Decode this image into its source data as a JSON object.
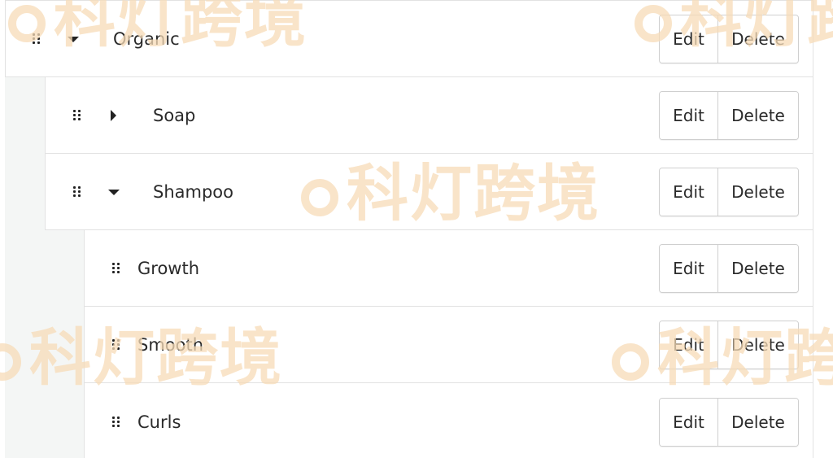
{
  "watermark": {
    "text": "科灯跨境",
    "icon": "bulb-logo-icon"
  },
  "tree": {
    "organic": {
      "label": "Organic",
      "state": "expanded",
      "edit_label": "Edit",
      "delete_label": "Delete"
    },
    "soap": {
      "label": "Soap",
      "state": "collapsed",
      "edit_label": "Edit",
      "delete_label": "Delete"
    },
    "shampoo": {
      "label": "Shampoo",
      "state": "expanded",
      "edit_label": "Edit",
      "delete_label": "Delete"
    },
    "growth": {
      "label": "Growth",
      "edit_label": "Edit",
      "delete_label": "Delete"
    },
    "smooth": {
      "label": "Smooth",
      "edit_label": "Edit",
      "delete_label": "Delete"
    },
    "curls": {
      "label": "Curls",
      "edit_label": "Edit",
      "delete_label": "Delete"
    }
  },
  "icons": {
    "drag": "drag-handle-icon",
    "expanded": "caret-down-icon",
    "collapsed": "caret-right-icon"
  },
  "colors": {
    "border": "#e2e2e2",
    "indent_bg": "#f4f6f5",
    "watermark": "#f7dcb8"
  }
}
